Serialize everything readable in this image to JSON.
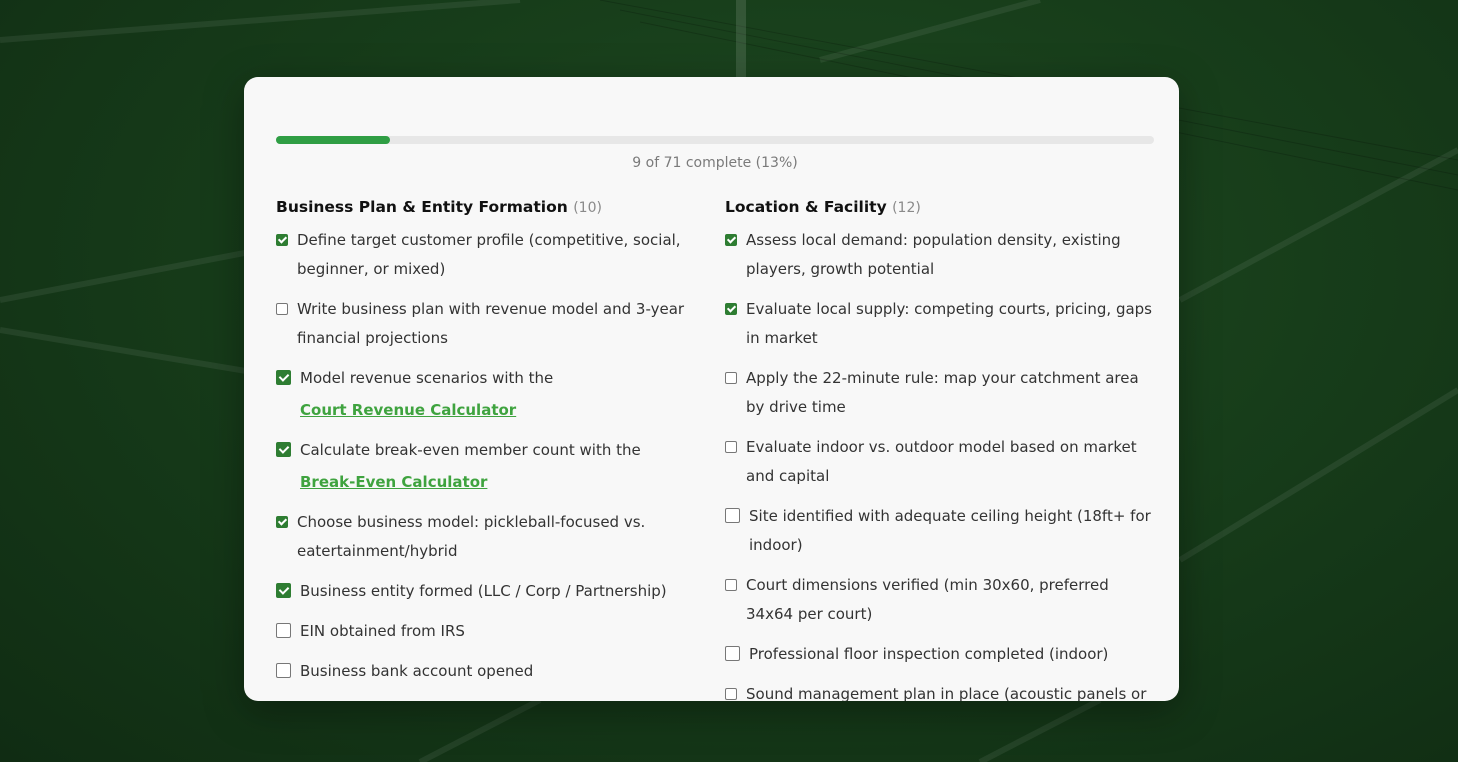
{
  "progress": {
    "completed": 9,
    "total": 71,
    "percent": 13,
    "label": "9 of 71 complete (13%)"
  },
  "colors": {
    "accent": "#2f9e44",
    "link": "#3fa33f",
    "checkbox_checked": "#2e7d32",
    "background": "#173d1a"
  },
  "sections": [
    {
      "title": "Business Plan & Entity Formation",
      "count": "(10)",
      "items": [
        {
          "text": "Define target customer profile (competitive, social, beginner, or mixed)",
          "checked": true
        },
        {
          "text": "Write business plan with revenue model and 3-year financial projections",
          "checked": false
        },
        {
          "text": "Model revenue scenarios with the",
          "link": "Court Revenue Calculator",
          "checked": true
        },
        {
          "text": "Calculate break-even member count with the",
          "link": "Break-Even Calculator",
          "checked": true
        },
        {
          "text": "Choose business model: pickleball-focused vs. eatertainment/hybrid",
          "checked": true
        },
        {
          "text": "Business entity formed (LLC / Corp / Partnership)",
          "checked": true
        },
        {
          "text": "EIN obtained from IRS",
          "checked": false
        },
        {
          "text": "Business bank account opened",
          "checked": false
        }
      ]
    },
    {
      "title": "Location & Facility",
      "count": "(12)",
      "items": [
        {
          "text": "Assess local demand: population density, existing players, growth potential",
          "checked": true
        },
        {
          "text": "Evaluate local supply: competing courts, pricing, gaps in market",
          "checked": true
        },
        {
          "text": "Apply the 22-minute rule: map your catchment area by drive time",
          "checked": false
        },
        {
          "text": "Evaluate indoor vs. outdoor model based on market and capital",
          "checked": false
        },
        {
          "text": "Site identified with adequate ceiling height (18ft+ for indoor)",
          "checked": false
        },
        {
          "text": "Court dimensions verified (min 30x60, preferred 34x64 per court)",
          "checked": false
        },
        {
          "text": "Professional floor inspection completed (indoor)",
          "checked": false
        },
        {
          "text": "Sound management plan in place (acoustic panels or",
          "checked": false
        }
      ]
    }
  ]
}
